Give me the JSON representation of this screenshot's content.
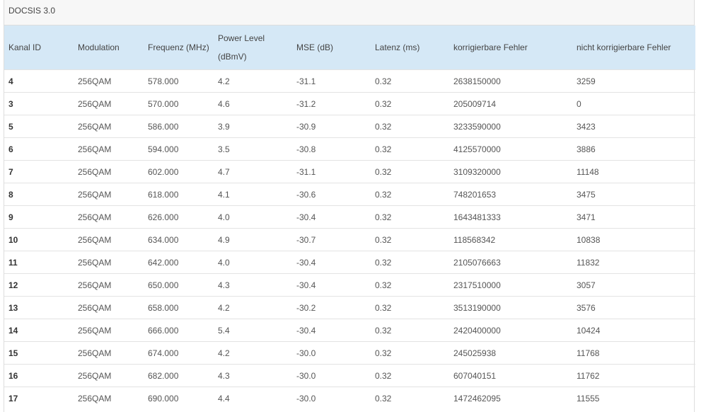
{
  "panel": {
    "title": "DOCSIS 3.0"
  },
  "table": {
    "headers": [
      "Kanal ID",
      "Modulation",
      "Frequenz (MHz)",
      "Power Level (dBmV)",
      "MSE (dB)",
      "Latenz (ms)",
      "korrigierbare Fehler",
      "nicht korrigierbare Fehler"
    ],
    "rows": [
      [
        "4",
        "256QAM",
        "578.000",
        "4.2",
        "-31.1",
        "0.32",
        "2638150000",
        "3259"
      ],
      [
        "3",
        "256QAM",
        "570.000",
        "4.6",
        "-31.2",
        "0.32",
        "205009714",
        "0"
      ],
      [
        "5",
        "256QAM",
        "586.000",
        "3.9",
        "-30.9",
        "0.32",
        "3233590000",
        "3423"
      ],
      [
        "6",
        "256QAM",
        "594.000",
        "3.5",
        "-30.8",
        "0.32",
        "4125570000",
        "3886"
      ],
      [
        "7",
        "256QAM",
        "602.000",
        "4.7",
        "-31.1",
        "0.32",
        "3109320000",
        "11148"
      ],
      [
        "8",
        "256QAM",
        "618.000",
        "4.1",
        "-30.6",
        "0.32",
        "748201653",
        "3475"
      ],
      [
        "9",
        "256QAM",
        "626.000",
        "4.0",
        "-30.4",
        "0.32",
        "1643481333",
        "3471"
      ],
      [
        "10",
        "256QAM",
        "634.000",
        "4.9",
        "-30.7",
        "0.32",
        "118568342",
        "10838"
      ],
      [
        "11",
        "256QAM",
        "642.000",
        "4.0",
        "-30.4",
        "0.32",
        "2105076663",
        "11832"
      ],
      [
        "12",
        "256QAM",
        "650.000",
        "4.3",
        "-30.4",
        "0.32",
        "2317510000",
        "3057"
      ],
      [
        "13",
        "256QAM",
        "658.000",
        "4.2",
        "-30.2",
        "0.32",
        "3513190000",
        "3576"
      ],
      [
        "14",
        "256QAM",
        "666.000",
        "5.4",
        "-30.4",
        "0.32",
        "2420400000",
        "10424"
      ],
      [
        "15",
        "256QAM",
        "674.000",
        "4.2",
        "-30.0",
        "0.32",
        "245025938",
        "11768"
      ],
      [
        "16",
        "256QAM",
        "682.000",
        "4.3",
        "-30.0",
        "0.32",
        "607040151",
        "11762"
      ],
      [
        "17",
        "256QAM",
        "690.000",
        "4.4",
        "-30.0",
        "0.32",
        "1472462095",
        "11555"
      ]
    ]
  }
}
